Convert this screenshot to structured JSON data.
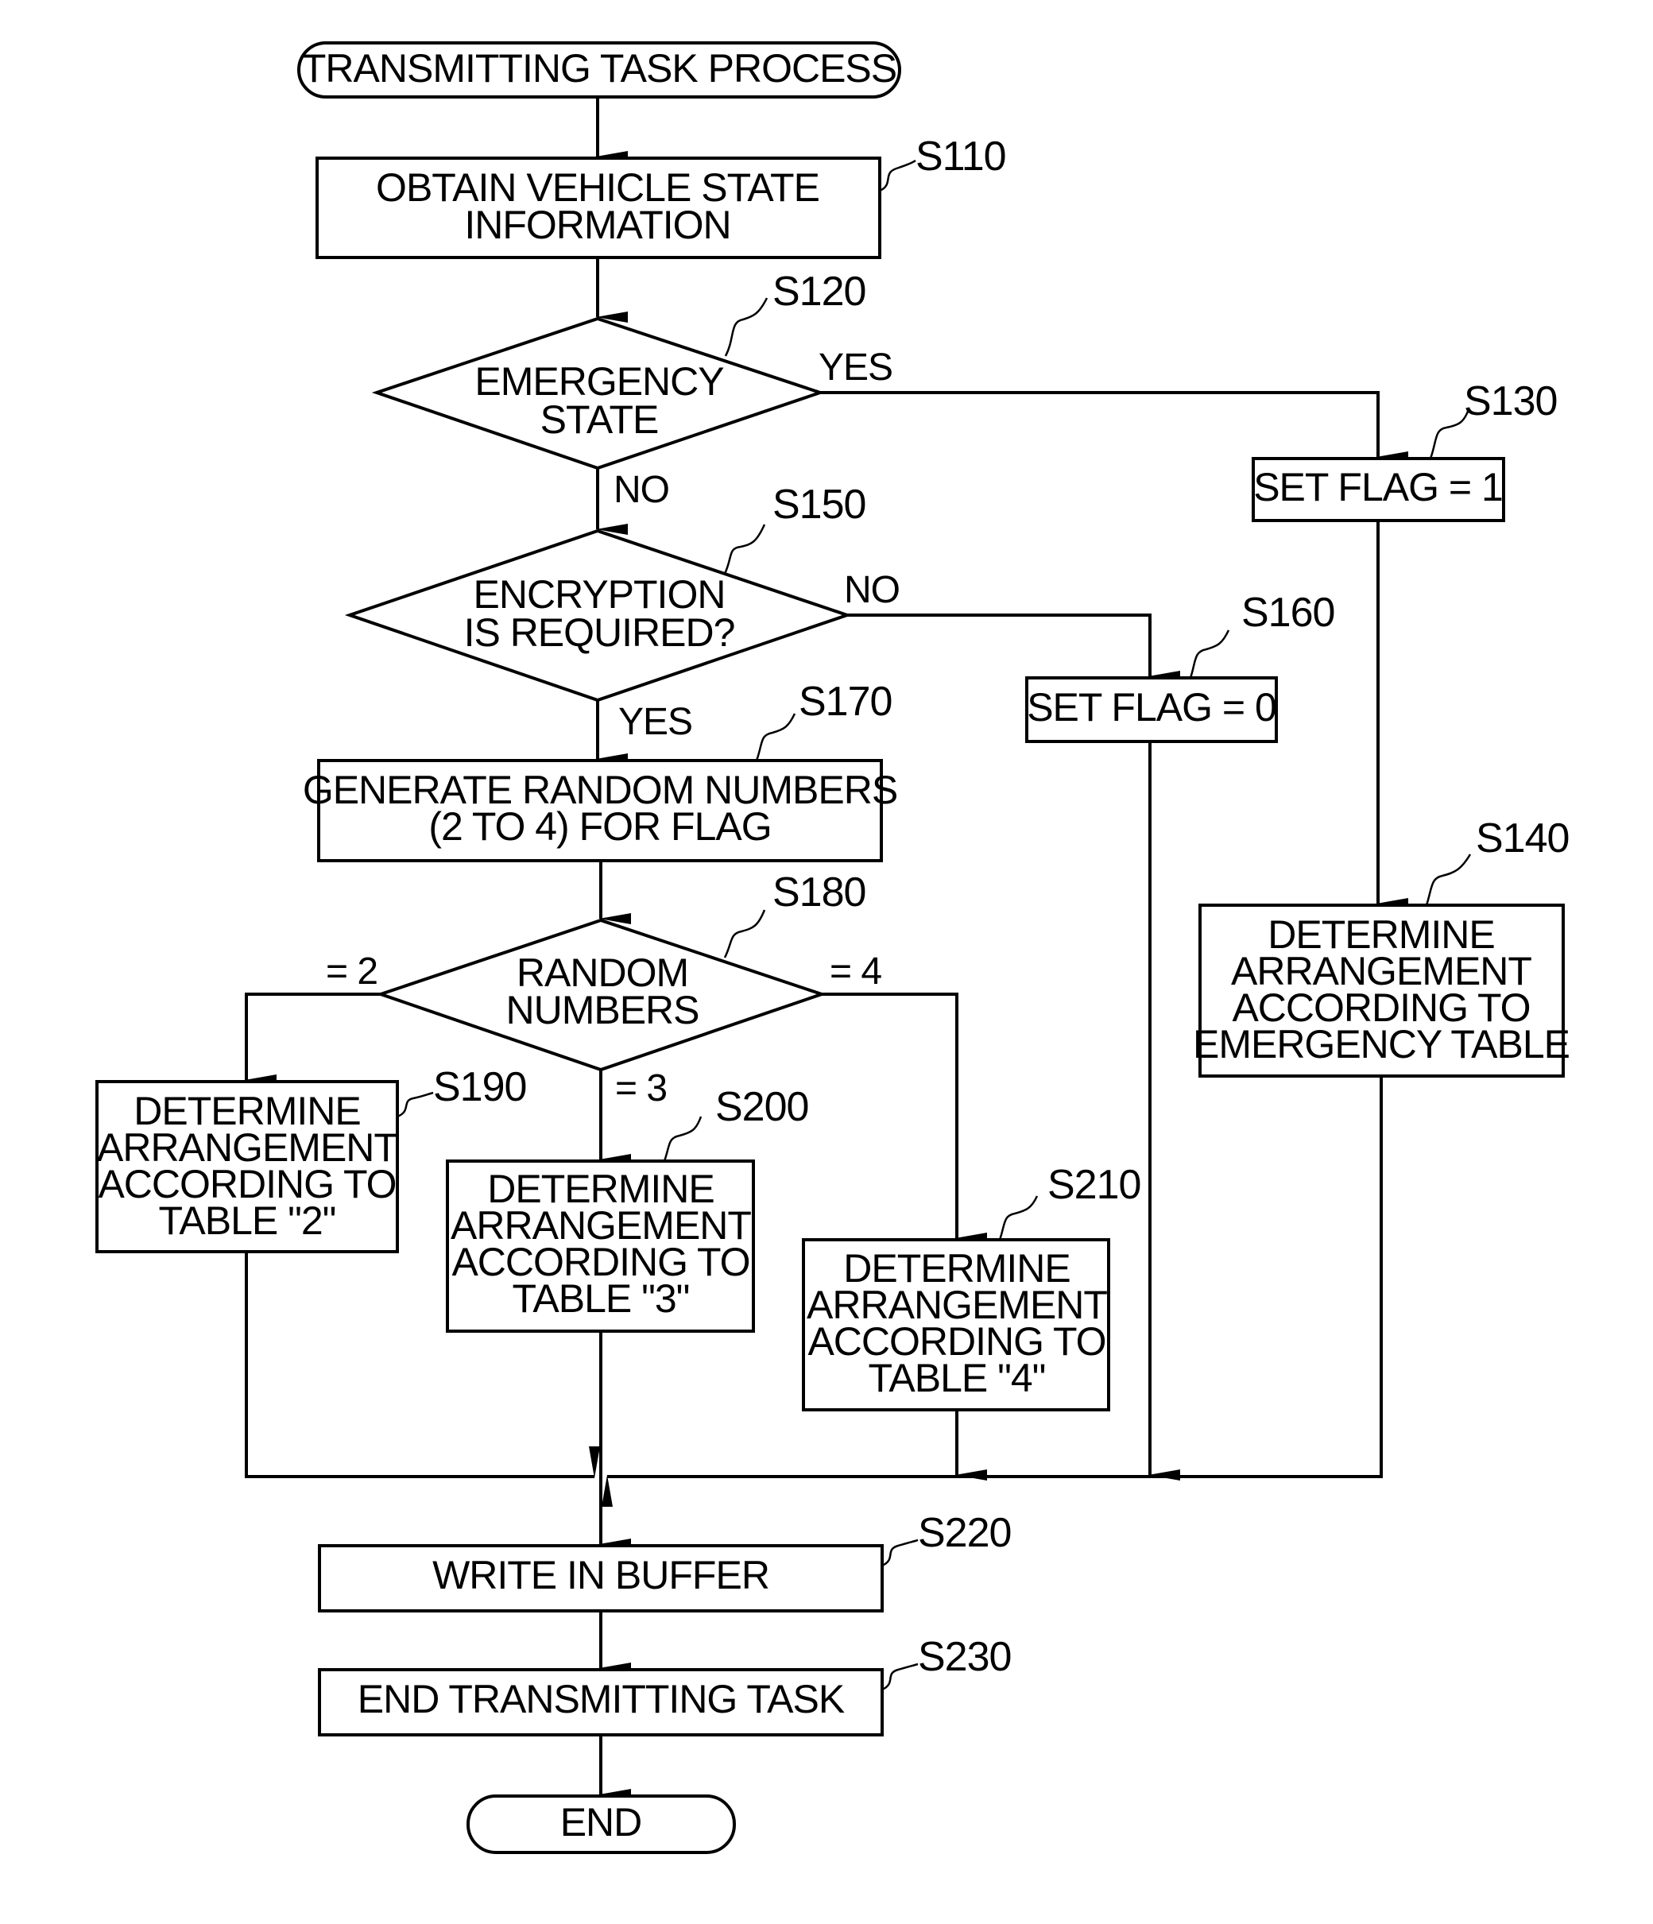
{
  "diagram": {
    "type": "flowchart",
    "start": {
      "label": "TRANSMITTING TASK PROCESS"
    },
    "end": {
      "label": "END"
    },
    "steps": {
      "s110": {
        "id": "S110",
        "lines": [
          "OBTAIN VEHICLE STATE",
          "INFORMATION"
        ]
      },
      "s120": {
        "id": "S120",
        "lines": [
          "EMERGENCY",
          "STATE"
        ]
      },
      "s130": {
        "id": "S130",
        "lines": [
          "SET FLAG = 1"
        ]
      },
      "s140": {
        "id": "S140",
        "lines": [
          "DETERMINE",
          "ARRANGEMENT",
          "ACCORDING TO",
          "EMERGENCY TABLE"
        ]
      },
      "s150": {
        "id": "S150",
        "lines": [
          "ENCRYPTION",
          "IS REQUIRED?"
        ]
      },
      "s160": {
        "id": "S160",
        "lines": [
          "SET FLAG = 0"
        ]
      },
      "s170": {
        "id": "S170",
        "lines": [
          "GENERATE RANDOM NUMBERS",
          "(2 TO 4) FOR FLAG"
        ]
      },
      "s180": {
        "id": "S180",
        "lines": [
          "RANDOM",
          "NUMBERS"
        ]
      },
      "s190": {
        "id": "S190",
        "lines": [
          "DETERMINE",
          "ARRANGEMENT",
          "ACCORDING TO",
          "TABLE \"2\""
        ]
      },
      "s200": {
        "id": "S200",
        "lines": [
          "DETERMINE",
          "ARRANGEMENT",
          "ACCORDING TO",
          "TABLE \"3\""
        ]
      },
      "s210": {
        "id": "S210",
        "lines": [
          "DETERMINE",
          "ARRANGEMENT",
          "ACCORDING TO",
          "TABLE \"4\""
        ]
      },
      "s220": {
        "id": "S220",
        "lines": [
          "WRITE IN BUFFER"
        ]
      },
      "s230": {
        "id": "S230",
        "lines": [
          "END TRANSMITTING TASK"
        ]
      }
    },
    "edge_labels": {
      "s120_yes": "YES",
      "s120_no": "NO",
      "s150_no": "NO",
      "s150_yes": "YES",
      "s180_eq2": "= 2",
      "s180_eq3": "= 3",
      "s180_eq4": "= 4"
    }
  }
}
